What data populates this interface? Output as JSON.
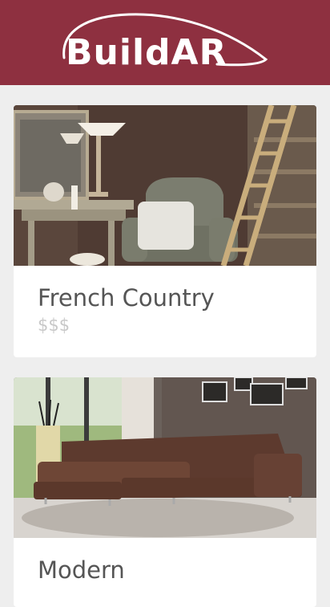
{
  "app": {
    "logo_text": "BuildAR",
    "brand_color": "#8e3040"
  },
  "cards": [
    {
      "title": "French Country",
      "price": "$$$"
    },
    {
      "title": "Modern",
      "price": ""
    }
  ]
}
